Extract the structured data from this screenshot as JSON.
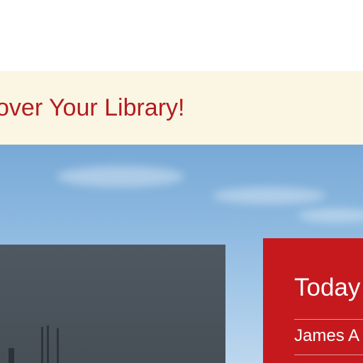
{
  "banner": {
    "text": "over Your Library!"
  },
  "today_panel": {
    "title": "Today",
    "first_item": "James A"
  },
  "colors": {
    "banner_background": "#fbf5e3",
    "banner_text": "#b31c1e",
    "panel_background": "#c5191e",
    "sky": "#8bb8df",
    "building": "#4a535b"
  }
}
